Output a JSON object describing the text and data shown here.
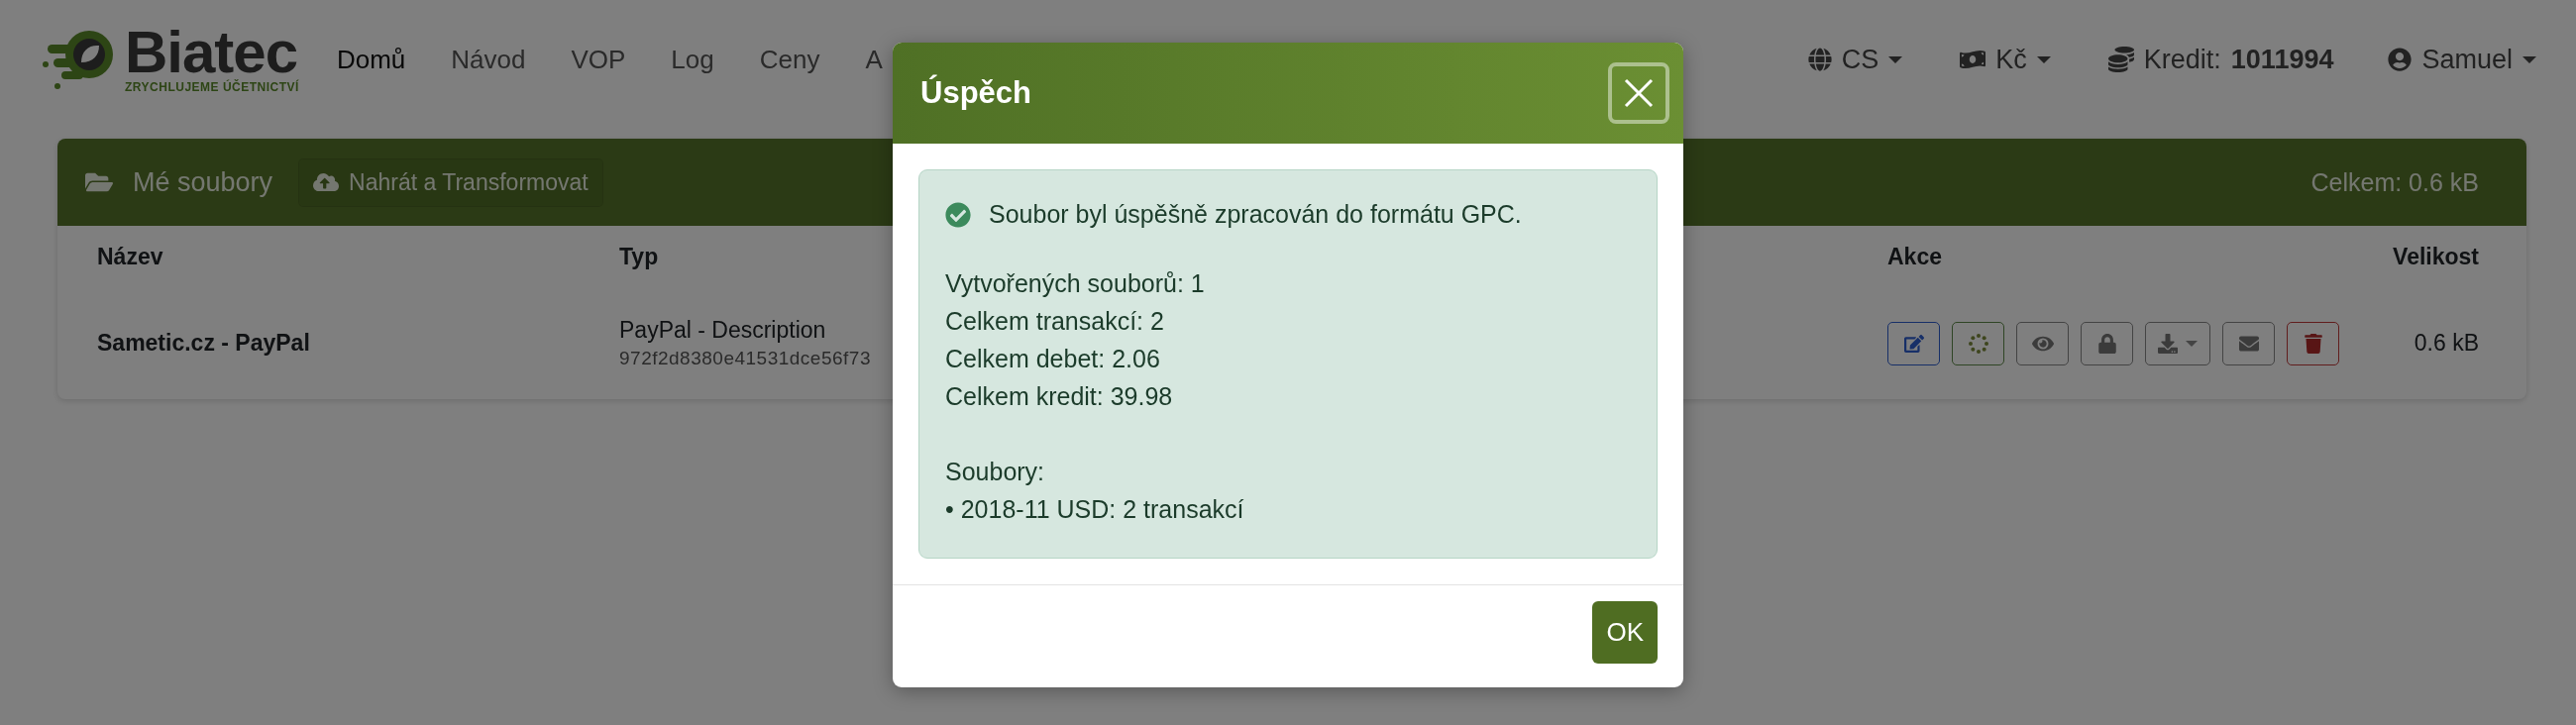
{
  "navbar": {
    "logo": {
      "name": "Biatec",
      "tagline": "ZRYCHLUJEME ÚČETNICTVÍ"
    },
    "nav_items": [
      {
        "label": "Domů",
        "selected": true
      },
      {
        "label": "Návod",
        "selected": false
      },
      {
        "label": "VOP",
        "selected": false
      },
      {
        "label": "Log",
        "selected": false
      },
      {
        "label": "Ceny",
        "selected": false
      },
      {
        "label": "A",
        "selected": false
      }
    ],
    "language": {
      "label": "CS"
    },
    "currency": {
      "label": "Kč"
    },
    "credit": {
      "label": "Kredit:",
      "value": "1011994"
    },
    "user": {
      "label": "Samuel"
    }
  },
  "files_card": {
    "title": "Mé soubory",
    "upload_button": "Nahrát a Transformovat",
    "total": "Celkem: 0.6 kB",
    "columns": [
      "Název",
      "Typ",
      "Akce",
      "Velikost"
    ],
    "rows": [
      {
        "name": "Sametic.cz - PayPal",
        "type": "PayPal - Description",
        "hash": "972f2d8380e41531dce56f73",
        "size": "0.6 kB",
        "actions": [
          {
            "kind": "edit"
          },
          {
            "kind": "processing"
          },
          {
            "kind": "view"
          },
          {
            "kind": "lock"
          },
          {
            "kind": "download"
          },
          {
            "kind": "email"
          },
          {
            "kind": "delete"
          }
        ]
      }
    ]
  },
  "modal": {
    "title": "Úspěch",
    "alert": {
      "message": "Soubor byl úspěšně zpracován do formátu GPC.",
      "stats": [
        "Vytvořených souborů: 1",
        "Celkem transakcí: 2",
        "Celkem debet: 2.06",
        "Celkem kredit: 39.98"
      ],
      "files_label": "Soubory:",
      "files": [
        "• 2018-11 USD: 2 transakcí"
      ]
    },
    "ok_button": "OK"
  }
}
